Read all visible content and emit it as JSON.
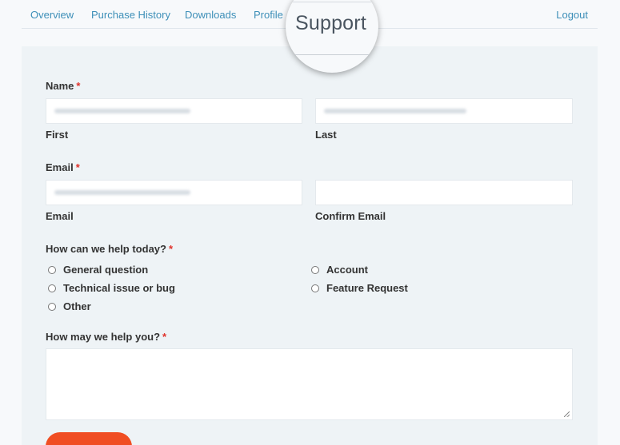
{
  "nav": {
    "items": [
      "Overview",
      "Purchase History",
      "Downloads",
      "Profile",
      "Support"
    ],
    "logout": "Logout"
  },
  "magnifier": {
    "text": "Support"
  },
  "form": {
    "required_mark": "*",
    "name": {
      "label": "Name",
      "first": "First",
      "last": "Last"
    },
    "email": {
      "label": "Email",
      "email": "Email",
      "confirm": "Confirm Email"
    },
    "help_today": {
      "label": "How can we help today?",
      "options": [
        "General question",
        "Account",
        "Technical issue or bug",
        "Feature Request",
        "Other"
      ]
    },
    "help_message": {
      "label": "How may we help you?"
    }
  },
  "colors": {
    "accent": "#3d8fb8",
    "required": "#e0322b",
    "submit": "#f04e23",
    "panel": "#eef3f6"
  }
}
